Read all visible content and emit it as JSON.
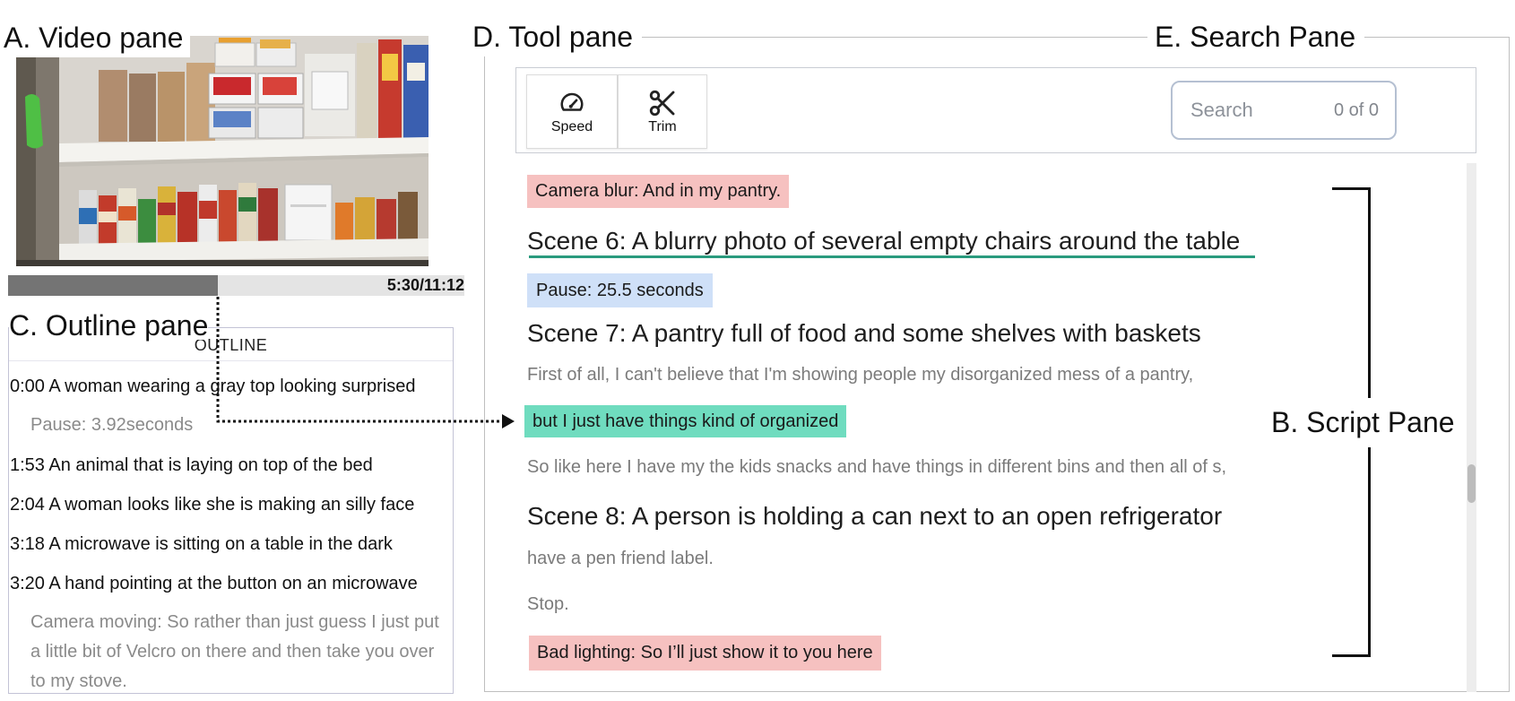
{
  "annotations": {
    "video_pane": "A. Video pane",
    "script_pane": "B. Script Pane",
    "outline_pane": "C. Outline pane",
    "tool_pane": "D. Tool pane",
    "search_pane": "E. Search Pane"
  },
  "video": {
    "time": "5:30/11:12",
    "progress": 0.46
  },
  "outline": {
    "header": "OUTLINE",
    "items": [
      "0:00 A woman wearing a gray top looking surprised",
      "Pause: 3.92seconds",
      "1:53 An animal that is laying on top of the bed",
      "2:04 A woman looks like she is making an silly face",
      "3:18 A microwave is sitting on a table in the dark",
      "3:20 A hand pointing at the button on an microwave",
      "Camera moving: So rather than just guess I just put a little bit of Velcro on there and then take you over to my stove."
    ]
  },
  "toolbar": {
    "speed": {
      "label": "Speed",
      "icon": "speedometer-icon"
    },
    "trim": {
      "label": "Trim",
      "icon": "scissors-icon"
    }
  },
  "search": {
    "placeholder": "Search",
    "count": "0 of 0"
  },
  "script": {
    "lines": [
      "Camera blur: And in my pantry.",
      "Scene 6: A blurry photo of several empty chairs around the table",
      "Pause: 25.5 seconds",
      "Scene 7: A pantry full of food and some shelves with baskets",
      "First of all, I can't believe that I'm showing people my disorganized mess of a pantry,",
      "but I just have things kind of organized",
      "So like here I have my the kids snacks and have things in different bins and then all of s,",
      "Scene 8: A person is holding a can next to an open refrigerator",
      "have a pen friend label.",
      "Stop.",
      "Bad lighting: So I’ll just show it to you here"
    ]
  },
  "colors": {
    "issue_highlight": "#f6c1c0",
    "pause_highlight": "#cfe0f8",
    "current_highlight": "#6fdcbf",
    "selected_underline": "#2a9b7e",
    "progress_fill": "#747474"
  }
}
